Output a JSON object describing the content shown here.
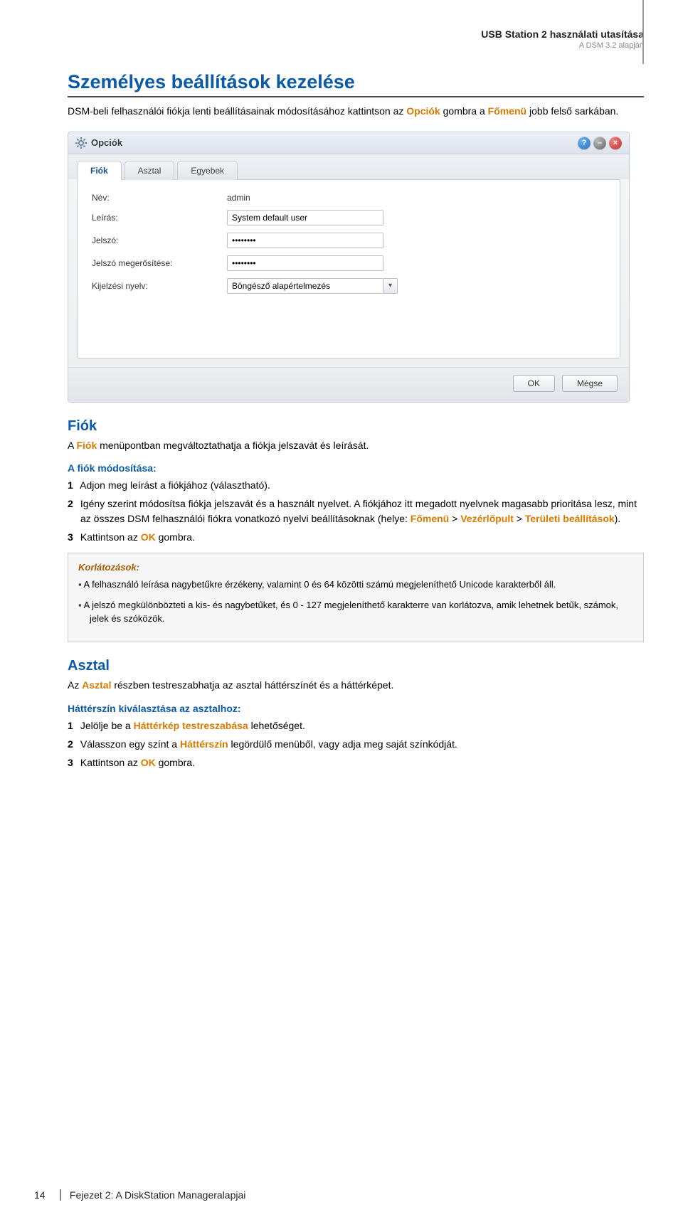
{
  "doc_header": {
    "line1": "USB Station 2 használati utasítása",
    "line2": "A DSM 3.2 alapján"
  },
  "section_title": "Személyes beállítások kezelése",
  "intro": {
    "pre": "DSM-beli felhasználói fiókja lenti beállításainak módosításához kattintson az ",
    "kw1": "Opciók",
    "mid": " gombra a ",
    "kw2": "Főmenü",
    "post": " jobb felső sarkában."
  },
  "dialog": {
    "title": "Opciók",
    "tabs": [
      "Fiók",
      "Asztal",
      "Egyebek"
    ],
    "fields": {
      "name_label": "Név:",
      "name_value": "admin",
      "desc_label": "Leírás:",
      "desc_value": "System default user",
      "pw_label": "Jelszó:",
      "pw_value": "••••••••",
      "pw2_label": "Jelszó megerősítése:",
      "pw2_value": "••••••••",
      "lang_label": "Kijelzési nyelv:",
      "lang_value": "Böngésző alapértelmezés"
    },
    "ok": "OK",
    "cancel": "Mégse"
  },
  "fiok": {
    "heading": "Fiók",
    "para": {
      "pre": "A ",
      "kw": "Fiók",
      "post": " menüpontban megváltoztathatja a fiókja jelszavát és leírását."
    },
    "mod_heading": "A fiók módosítása:",
    "steps": {
      "s1": "Adjon meg leírást a fiókjához (választható).",
      "s2a": "Igény szerint módosítsa fiókja jelszavát és a használt nyelvet. A fiókjához itt megadott nyelvnek magasabb prioritása lesz, mint az összes DSM felhasználói fiókra vonatkozó nyelvi beállításoknak (helye: ",
      "s2_kw1": "Főmenü",
      "s2_gt1": " > ",
      "s2_kw2": "Vezérlőpult",
      "s2_gt2": " > ",
      "s2_kw3": "Területi beállítások",
      "s2b": ").",
      "s3a": "Kattintson az ",
      "s3_kw": "OK",
      "s3b": " gombra."
    },
    "note_title": "Korlátozások:",
    "note1": "A felhasználó leírása nagybetűkre érzékeny, valamint 0 és 64 közötti számú megjeleníthető Unicode karakterből áll.",
    "note2": "A jelszó megkülönbözteti a kis- és nagybetűket, és 0 - 127 megjeleníthető karakterre van korlátozva, amik lehetnek betűk, számok, jelek és szóközök."
  },
  "asztal": {
    "heading": "Asztal",
    "para": {
      "pre": "Az ",
      "kw": "Asztal",
      "post": " részben testreszabhatja az asztal háttérszínét és a háttérképet."
    },
    "sub": "Háttérszín kiválasztása az asztalhoz:",
    "s1a": "Jelölje be a ",
    "s1_kw": "Háttérkép testreszabása",
    "s1b": " lehetőséget.",
    "s2a": "Válasszon egy színt a ",
    "s2_kw": "Háttérszín",
    "s2b": " legördülő menüből, vagy adja meg saját színkódját.",
    "s3a": "Kattintson az ",
    "s3_kw": "OK",
    "s3b": " gombra."
  },
  "footer": {
    "page_no": "14",
    "chapter": "Fejezet 2: A DiskStation Manageralapjai"
  }
}
